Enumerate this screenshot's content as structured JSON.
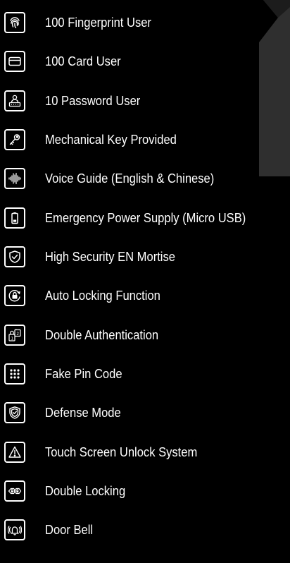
{
  "colors": {
    "background": "#000000",
    "foreground": "#ffffff",
    "accent_shape": "#2f2f2f"
  },
  "features": [
    {
      "label": "100 Fingerprint User",
      "icon": "fingerprint-icon"
    },
    {
      "label": "100 Card User",
      "icon": "card-icon"
    },
    {
      "label": "10 Password User",
      "icon": "password-user-icon"
    },
    {
      "label": "Mechanical Key Provided",
      "icon": "key-icon"
    },
    {
      "label": "Voice Guide (English & Chinese)",
      "icon": "voice-wave-icon"
    },
    {
      "label": "Emergency Power Supply (Micro USB)",
      "icon": "battery-icon"
    },
    {
      "label": "High Security EN Mortise",
      "icon": "shield-check-icon"
    },
    {
      "label": "Auto Locking Function",
      "icon": "auto-lock-icon"
    },
    {
      "label": "Double Authentication",
      "icon": "double-auth-icon"
    },
    {
      "label": "Fake Pin Code",
      "icon": "keypad-icon"
    },
    {
      "label": "Defense Mode",
      "icon": "defense-shield-icon"
    },
    {
      "label": "Touch Screen Unlock System",
      "icon": "warning-icon"
    },
    {
      "label": "Double Locking",
      "icon": "double-lock-icon"
    },
    {
      "label": "Door Bell",
      "icon": "bell-icon"
    }
  ]
}
